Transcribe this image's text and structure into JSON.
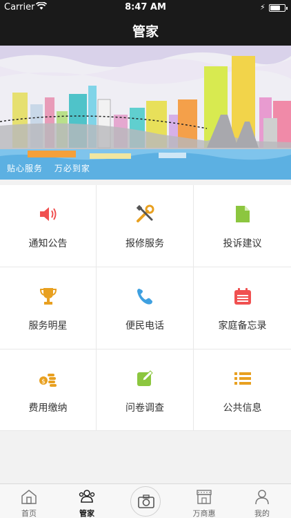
{
  "status_bar": {
    "carrier": "Carrier",
    "time": "8:47 AM"
  },
  "nav": {
    "title": "管家"
  },
  "banner": {
    "caption_left": "贴心服务",
    "caption_right": "万必到家"
  },
  "services": [
    {
      "label": "通知公告",
      "icon": "speaker-icon",
      "color": "#f05050"
    },
    {
      "label": "报修服务",
      "icon": "tools-icon",
      "color": "#e8a020"
    },
    {
      "label": "投诉建议",
      "icon": "document-icon",
      "color": "#8cc63f"
    },
    {
      "label": "服务明星",
      "icon": "trophy-icon",
      "color": "#e8a020"
    },
    {
      "label": "便民电话",
      "icon": "phone-icon",
      "color": "#3fa0e0"
    },
    {
      "label": "家庭备忘录",
      "icon": "calendar-icon",
      "color": "#f05050"
    },
    {
      "label": "费用缴纳",
      "icon": "coins-icon",
      "color": "#e8a020"
    },
    {
      "label": "问卷调查",
      "icon": "edit-icon",
      "color": "#8cc63f"
    },
    {
      "label": "公共信息",
      "icon": "list-icon",
      "color": "#e8a020"
    }
  ],
  "tabs": [
    {
      "label": "首页",
      "icon": "home-icon"
    },
    {
      "label": "管家",
      "icon": "people-icon",
      "active": true
    },
    {
      "label": "",
      "icon": "camera-icon"
    },
    {
      "label": "万商惠",
      "icon": "store-icon"
    },
    {
      "label": "我的",
      "icon": "user-icon"
    }
  ]
}
